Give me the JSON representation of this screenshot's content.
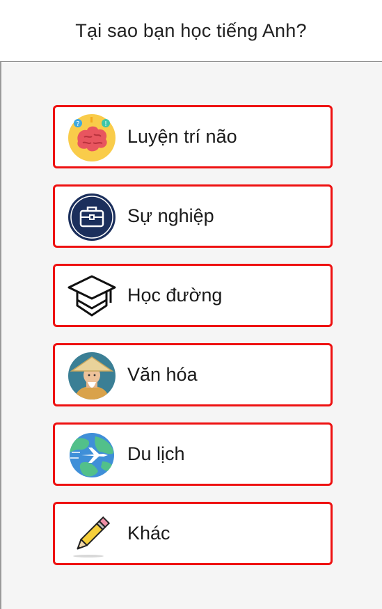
{
  "header": {
    "title": "Tại sao bạn học tiếng Anh?"
  },
  "options": [
    {
      "label": "Luyện trí não",
      "icon": "brain-icon"
    },
    {
      "label": "Sự nghiệp",
      "icon": "briefcase-icon"
    },
    {
      "label": "Học đường",
      "icon": "graduation-cap-icon"
    },
    {
      "label": "Văn hóa",
      "icon": "vietnamese-man-icon"
    },
    {
      "label": "Du lịch",
      "icon": "globe-airplane-icon"
    },
    {
      "label": "Khác",
      "icon": "pencil-icon"
    }
  ],
  "colors": {
    "option_border": "#ee1111",
    "background": "#f5f5f5",
    "header_bg": "#ffffff"
  }
}
